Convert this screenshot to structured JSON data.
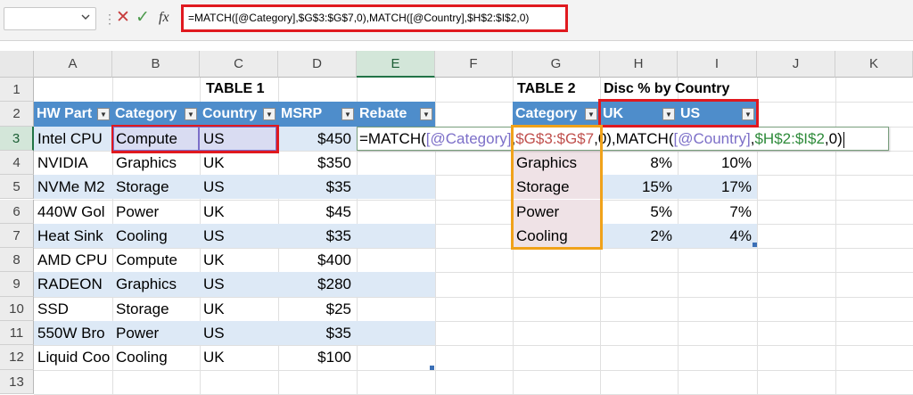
{
  "formula_bar": {
    "name_box": "",
    "formula": "=MATCH([@Category],$G$3:$G$7,0),MATCH([@Country],$H$2:$I$2,0)",
    "separator": "⋮",
    "cancel_icon": "✕",
    "enter_icon": "✓",
    "fx_label": "fx"
  },
  "columns": [
    "A",
    "B",
    "C",
    "D",
    "E",
    "F",
    "G",
    "H",
    "I",
    "J",
    "K"
  ],
  "rows": [
    "1",
    "2",
    "3",
    "4",
    "5",
    "6",
    "7",
    "8",
    "9",
    "10",
    "11",
    "12",
    "13"
  ],
  "table1": {
    "title": "TABLE 1",
    "headers": [
      "HW Part",
      "Category",
      "Country",
      "MSRP",
      "Rebate"
    ],
    "rows": [
      [
        "Intel CPU",
        "Compute",
        "US",
        "$450"
      ],
      [
        "NVIDIA",
        "Graphics",
        "UK",
        "$350"
      ],
      [
        "NVMe M2",
        "Storage",
        "US",
        "$35"
      ],
      [
        "440W Gol",
        "Power",
        "UK",
        "$45"
      ],
      [
        "Heat Sink",
        "Cooling",
        "US",
        "$35"
      ],
      [
        "AMD CPU",
        "Compute",
        "UK",
        "$400"
      ],
      [
        "RADEON",
        "Graphics",
        "US",
        "$280"
      ],
      [
        "SSD",
        "Storage",
        "UK",
        "$25"
      ],
      [
        "550W Bro",
        "Power",
        "US",
        "$35"
      ],
      [
        "Liquid Coo",
        "Cooling",
        "UK",
        "$100"
      ]
    ]
  },
  "edit_cell": {
    "prefix": "=MATCH(",
    "arg1": "[@Category]",
    "comma1": ",",
    "arg2": "$G$3:$G$7",
    "mid": ",0),MATCH(",
    "arg3": "[@Country]",
    "comma2": ",",
    "arg4": "$H$2:$I$2",
    "suffix": ",0)"
  },
  "table2": {
    "title": "TABLE 2",
    "subtitle": "Disc % by Country",
    "headers": [
      "Category",
      "UK",
      "US"
    ],
    "rows": [
      [
        "Graphics",
        "8%",
        "10%"
      ],
      [
        "Storage",
        "15%",
        "17%"
      ],
      [
        "Power",
        "5%",
        "7%"
      ],
      [
        "Cooling",
        "2%",
        "4%"
      ]
    ]
  },
  "colors": {
    "header_blue": "#4e8dcb",
    "band_blue": "#dde9f6",
    "highlight_red": "#e0191f",
    "highlight_orange": "#f0a21a",
    "ref_purple": "#7c6fc8",
    "ref_red": "#c0504d",
    "ref_green": "#2e8b3a"
  }
}
